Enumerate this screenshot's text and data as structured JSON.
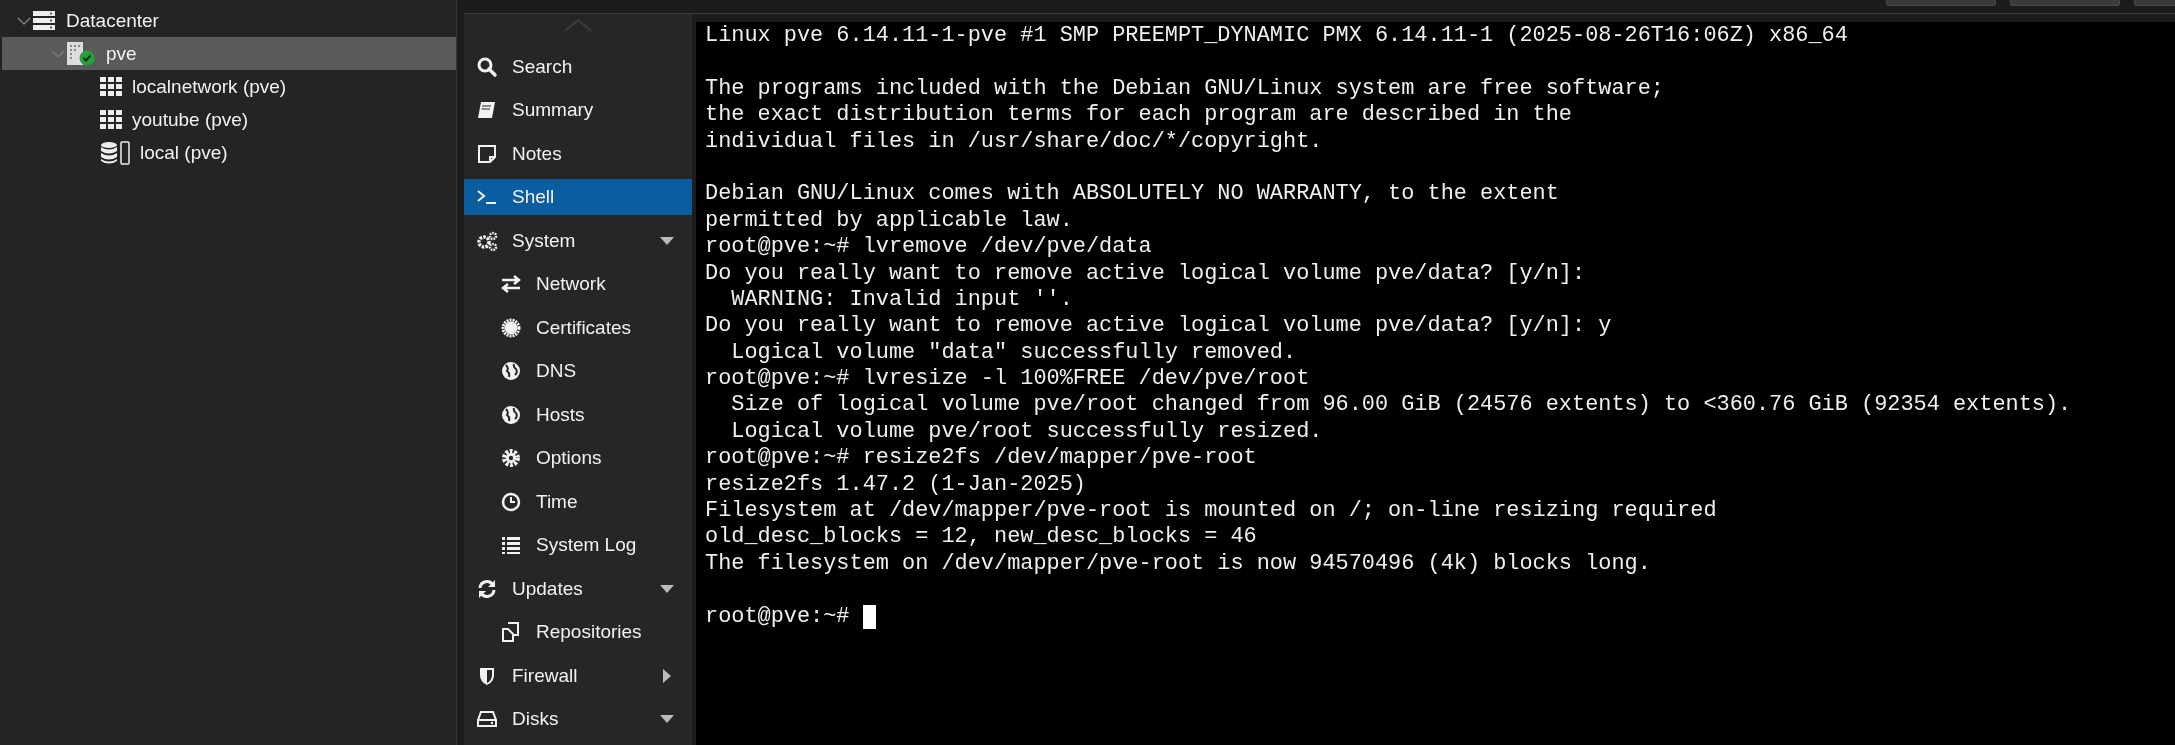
{
  "tree": [
    {
      "label": "Datacenter",
      "kind": "datacenter",
      "expanded": true,
      "selected": false,
      "children": [
        {
          "label": "pve",
          "kind": "node",
          "online": true,
          "expanded": true,
          "selected": true,
          "children": [
            {
              "label": "localnetwork (pve)",
              "kind": "network",
              "selected": false
            },
            {
              "label": "youtube (pve)",
              "kind": "network",
              "selected": false
            },
            {
              "label": "local (pve)",
              "kind": "storage",
              "selected": false
            }
          ]
        }
      ]
    }
  ],
  "nav": [
    {
      "label": "Search",
      "kind": "search",
      "selected": false
    },
    {
      "label": "Summary",
      "kind": "book",
      "selected": false
    },
    {
      "label": "Notes",
      "kind": "note",
      "selected": false
    },
    {
      "label": "Shell",
      "kind": "terminal",
      "selected": true
    },
    {
      "label": "System",
      "kind": "gears",
      "selected": false,
      "expanded": true,
      "children": [
        {
          "label": "Network",
          "kind": "exchange",
          "selected": false
        },
        {
          "label": "Certificates",
          "kind": "certificate",
          "selected": false
        },
        {
          "label": "DNS",
          "kind": "globe",
          "selected": false
        },
        {
          "label": "Hosts",
          "kind": "globe",
          "selected": false
        },
        {
          "label": "Options",
          "kind": "gear",
          "selected": false
        },
        {
          "label": "Time",
          "kind": "clock",
          "selected": false
        },
        {
          "label": "System Log",
          "kind": "list",
          "selected": false
        }
      ]
    },
    {
      "label": "Updates",
      "kind": "refresh",
      "selected": false,
      "expanded": true,
      "children": [
        {
          "label": "Repositories",
          "kind": "files",
          "selected": false
        }
      ]
    },
    {
      "label": "Firewall",
      "kind": "shield",
      "selected": false,
      "expanded": false
    },
    {
      "label": "Disks",
      "kind": "drive",
      "selected": false,
      "expanded": true
    }
  ],
  "terminal": {
    "lines": [
      {
        "text": "Linux pve 6.14.11-1-pve #1 SMP PREEMPT_DYNAMIC PMX 6.14.11-1 (2025-08-26T16:06Z) x86_64"
      },
      {
        "text": "The programs included with the Debian GNU/Linux system are free software;",
        "blank_before": true
      },
      {
        "text": "the exact distribution terms for each program are described in the"
      },
      {
        "text": "individual files in /usr/share/doc/*/copyright."
      },
      {
        "text": "Debian GNU/Linux comes with ABSOLUTELY NO WARRANTY, to the extent",
        "blank_before": true
      },
      {
        "text": "permitted by applicable law."
      },
      {
        "text": "root@pve:~# lvremove /dev/pve/data"
      },
      {
        "text": "Do you really want to remove active logical volume pve/data? [y/n]:"
      },
      {
        "text": "  WARNING: Invalid input ''."
      },
      {
        "text": "Do you really want to remove active logical volume pve/data? [y/n]: y"
      },
      {
        "text": "  Logical volume \"data\" successfully removed."
      },
      {
        "text": "root@pve:~# lvresize -l 100%FREE /dev/pve/root"
      },
      {
        "text": "  Size of logical volume pve/root changed from 96.00 GiB (24576 extents) to <360.76 GiB (92354 extents)."
      },
      {
        "text": "  Logical volume pve/root successfully resized."
      },
      {
        "text": "root@pve:~# resize2fs /dev/mapper/pve-root"
      },
      {
        "text": "resize2fs 1.47.2 (1-Jan-2025)"
      },
      {
        "text": "Filesystem at /dev/mapper/pve-root is mounted on /; on-line resizing required"
      },
      {
        "text": "old_desc_blocks = 12, new_desc_blocks = 46"
      },
      {
        "text": "The filesystem on /dev/mapper/pve-root is now 94570496 (4k) blocks long."
      },
      {
        "text": "root@pve:~# ",
        "blank_before": true,
        "cursor": true
      }
    ]
  }
}
